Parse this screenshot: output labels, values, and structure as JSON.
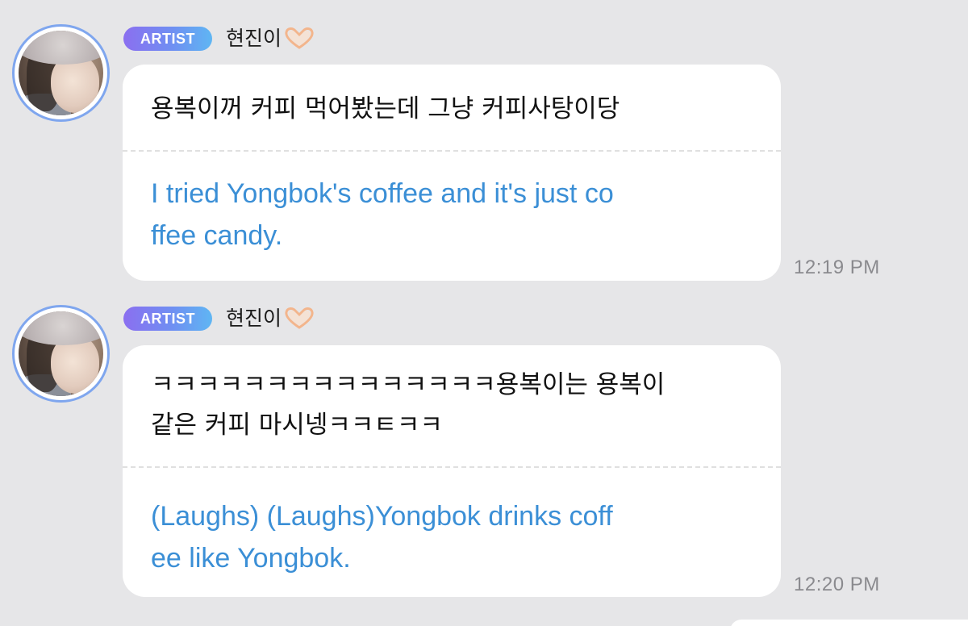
{
  "messages": [
    {
      "badge": "ARTIST",
      "username": "현진이",
      "emoji_icon": "heart-hands-icon",
      "original_lines": "용복이꺼 커피 먹어봤는데 그냥 커피사탕이당",
      "translation_lines": "I tried Yongbok's coffee and it's just co\nffee candy.",
      "time": "12:19 PM"
    },
    {
      "badge": "ARTIST",
      "username": "현진이",
      "emoji_icon": "heart-hands-icon",
      "original_lines": "ㅋㅋㅋㅋㅋㅋㅋㅋㅋㅋㅋㅋㅋㅋㅋ용복이는 용복이\n같은 커피 마시넹ㅋㅋㅌㅋㅋ",
      "translation_lines": "(Laughs) (Laughs)Yongbok drinks coff\nee like Yongbok.",
      "time": "12:20 PM"
    }
  ],
  "colors": {
    "background": "#e6e6e8",
    "bubble": "#ffffff",
    "translation_text": "#3b8fd6",
    "badge_gradient_start": "#8b6ff0",
    "badge_gradient_end": "#5fb6f3",
    "avatar_ring": "#7fa6ee",
    "timestamp": "#8a8a8e"
  }
}
